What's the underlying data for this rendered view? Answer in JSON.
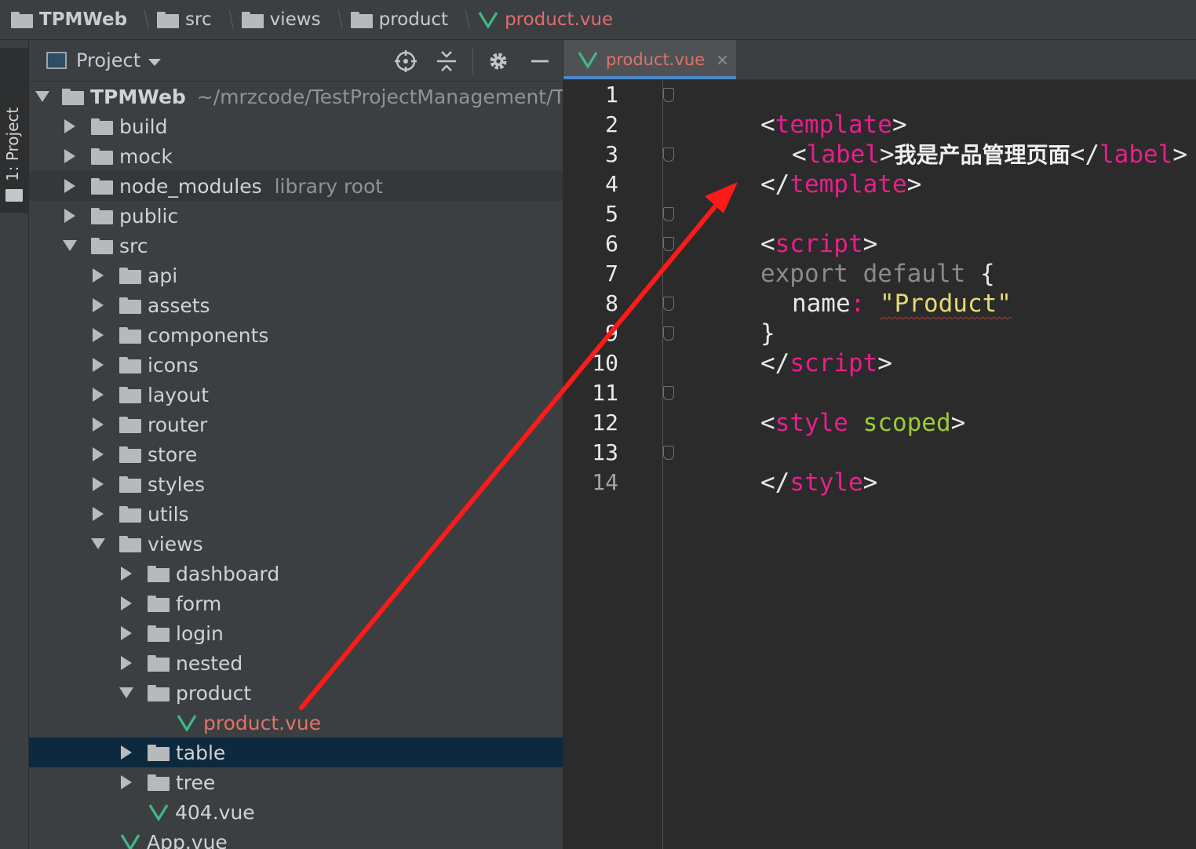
{
  "breadcrumb": {
    "items": [
      {
        "label": "TPMWeb",
        "icon": "folder-icon"
      },
      {
        "label": "src",
        "icon": "folder-icon"
      },
      {
        "label": "views",
        "icon": "folder-icon"
      },
      {
        "label": "product",
        "icon": "folder-icon"
      },
      {
        "label": "product.vue",
        "icon": "vue-file-icon"
      }
    ]
  },
  "toolstrip": {
    "project_tab_label": "1: Project"
  },
  "panel": {
    "title": "Project",
    "icons": [
      "locate-icon",
      "collapse-all-icon",
      "gear-icon",
      "minimize-icon"
    ]
  },
  "tree": {
    "root_name": "TPMWeb",
    "root_path": "~/mrzcode/TestProjectManagement/TF",
    "build": "build",
    "mock": "mock",
    "node_modules": "node_modules",
    "node_modules_note": "library root",
    "public": "public",
    "src": "src",
    "api": "api",
    "assets": "assets",
    "components": "components",
    "icons": "icons",
    "layout": "layout",
    "router": "router",
    "store": "store",
    "styles": "styles",
    "utils": "utils",
    "views": "views",
    "dashboard": "dashboard",
    "form": "form",
    "login": "login",
    "nested": "nested",
    "product": "product",
    "product_vue": "product.vue",
    "table": "table",
    "tree": "tree",
    "vue404": "404.vue",
    "app_vue": "App.vue"
  },
  "editor": {
    "tab_label": "product.vue",
    "tab_close": "×",
    "line_numbers": [
      "1",
      "2",
      "3",
      "4",
      "5",
      "6",
      "7",
      "8",
      "9",
      "10",
      "11",
      "12",
      "13",
      "14"
    ],
    "code": {
      "l1_open": "<",
      "l1_tag": "template",
      "l1_close": ">",
      "l2_open": "<",
      "l2_tag": "label",
      "l2_gt": ">",
      "l2_text": "我是产品管理页面",
      "l2_endopen": "</",
      "l2_endtag": "label",
      "l2_endclose": ">",
      "l3_open": "</",
      "l3_tag": "template",
      "l3_close": ">",
      "l5_open": "<",
      "l5_tag": "script",
      "l5_close": ">",
      "l6_kw": "export default",
      "l6_brace": " {",
      "l7_key": "name",
      "l7_colon": ": ",
      "l7_str": "\"Product\"",
      "l8_brace": "}",
      "l9_open": "</",
      "l9_tag": "script",
      "l9_close": ">",
      "l11_open": "<",
      "l11_tag": "style",
      "l11_attr": "scoped",
      "l11_close": ">",
      "l13_open": "</",
      "l13_tag": "style",
      "l13_close": ">"
    }
  },
  "colors": {
    "vue_green": "#41b883",
    "vue_file_text": "#e07368",
    "tag_pink": "#e91e8c",
    "annotation_arrow": "#ff1a1a"
  }
}
